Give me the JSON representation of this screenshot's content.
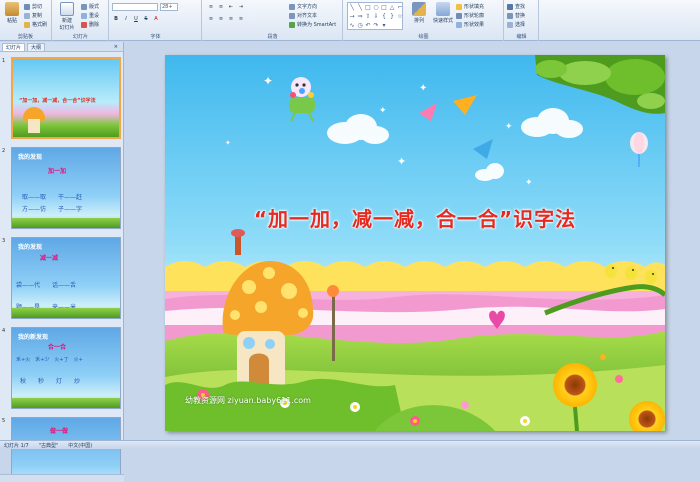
{
  "ribbon": {
    "clipboard": {
      "paste": "粘贴",
      "cut": "剪切",
      "copy": "复制",
      "format_painter": "格式刷",
      "group": "剪贴板"
    },
    "slides": {
      "new_slide": "新建\n幻灯片",
      "layout": "版式",
      "reset": "重设",
      "delete": "删除",
      "group": "幻灯片"
    },
    "font": {
      "font_name": "",
      "font_size": "28+",
      "group": "字体"
    },
    "paragraph": {
      "text_direction": "文字方向",
      "align_text": "对齐文本",
      "smartart": "转换为 SmartArt",
      "group": "段落"
    },
    "drawing": {
      "arrange": "排列",
      "quick_styles": "快速样式",
      "shape_fill": "形状填充",
      "shape_outline": "形状轮廓",
      "shape_effects": "形状效果",
      "group": "绘图"
    },
    "editing": {
      "find": "查找",
      "replace": "替换",
      "select": "选择",
      "group": "编辑"
    }
  },
  "panel": {
    "tabs": [
      "幻灯片",
      "大纲"
    ],
    "thumbnails": [
      {
        "num": "1",
        "title": "“加一加，减一减，合一合”识字法"
      },
      {
        "num": "2",
        "heading": "我的发现",
        "big": "加一加",
        "lines": [
          "取——取　　干——赶",
          "方——仿　　子——字"
        ]
      },
      {
        "num": "3",
        "heading": "我的发现",
        "big": "减一减",
        "lines": [
          "袋——代　　话——舌",
          "题——是　　来——米"
        ]
      },
      {
        "num": "4",
        "heading": "我的新发现",
        "big": "合一合",
        "lines": [
          "禾+火　禾+少　火+丁　火+",
          "秋　　秒　　灯　　炒"
        ]
      },
      {
        "num": "5",
        "heading": "",
        "big": "做一做",
        "lines": []
      }
    ]
  },
  "slide": {
    "title": "“加一加，减一减，合一合”识字法",
    "watermark": "幼教资源网 ziyuan.baby611.com"
  },
  "status": {
    "slide_count": "幻灯片 1/7",
    "theme": "\"古典型\"",
    "language": "中文(中国)"
  },
  "colors": {
    "title_red": "#e52a22",
    "sky": "#5cc3ef",
    "grass": "#7cc63a",
    "thumb_selected": "#f3a64a"
  }
}
